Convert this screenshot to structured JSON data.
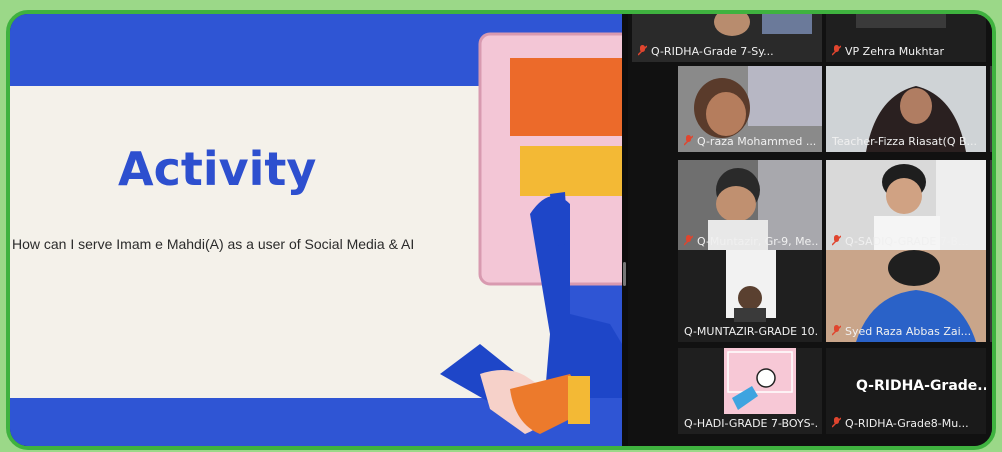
{
  "slide": {
    "title": "Activity",
    "question": "How can I serve Imam e Mahdi(A) as a user of Social Media & AI"
  },
  "gallery": {
    "tiles": [
      {
        "label": "Q-RIDHA-Grade 7-Sy...",
        "muted": true
      },
      {
        "label": "VP Zehra Mukhtar",
        "muted": true
      },
      {
        "label": "Q-raza Mohammed ...",
        "muted": true
      },
      {
        "label": "Teacher-Fizza Riasat(Q B...",
        "muted": false,
        "active_speaker": true
      },
      {
        "label": "Q-Muntazir, Gr-9, Me...",
        "muted": true
      },
      {
        "label": "Q-SADIQ-GRADE 7-B...",
        "muted": true
      },
      {
        "label": "Q-MUNTAZIR-GRADE 10...",
        "muted": false
      },
      {
        "label": "Syed Raza Abbas Zai...",
        "muted": true
      },
      {
        "label": "Q-HADI-GRADE 7-BOYS-...",
        "muted": false
      },
      {
        "label": "Q-RIDHA-Grade8-Mu...",
        "muted": true
      }
    ],
    "name_only_title": "Q-RIDHA-Grade...",
    "colors": {
      "frame": "#3fb23f",
      "muted_icon": "#e0452e",
      "active": "#6ad24a"
    }
  }
}
